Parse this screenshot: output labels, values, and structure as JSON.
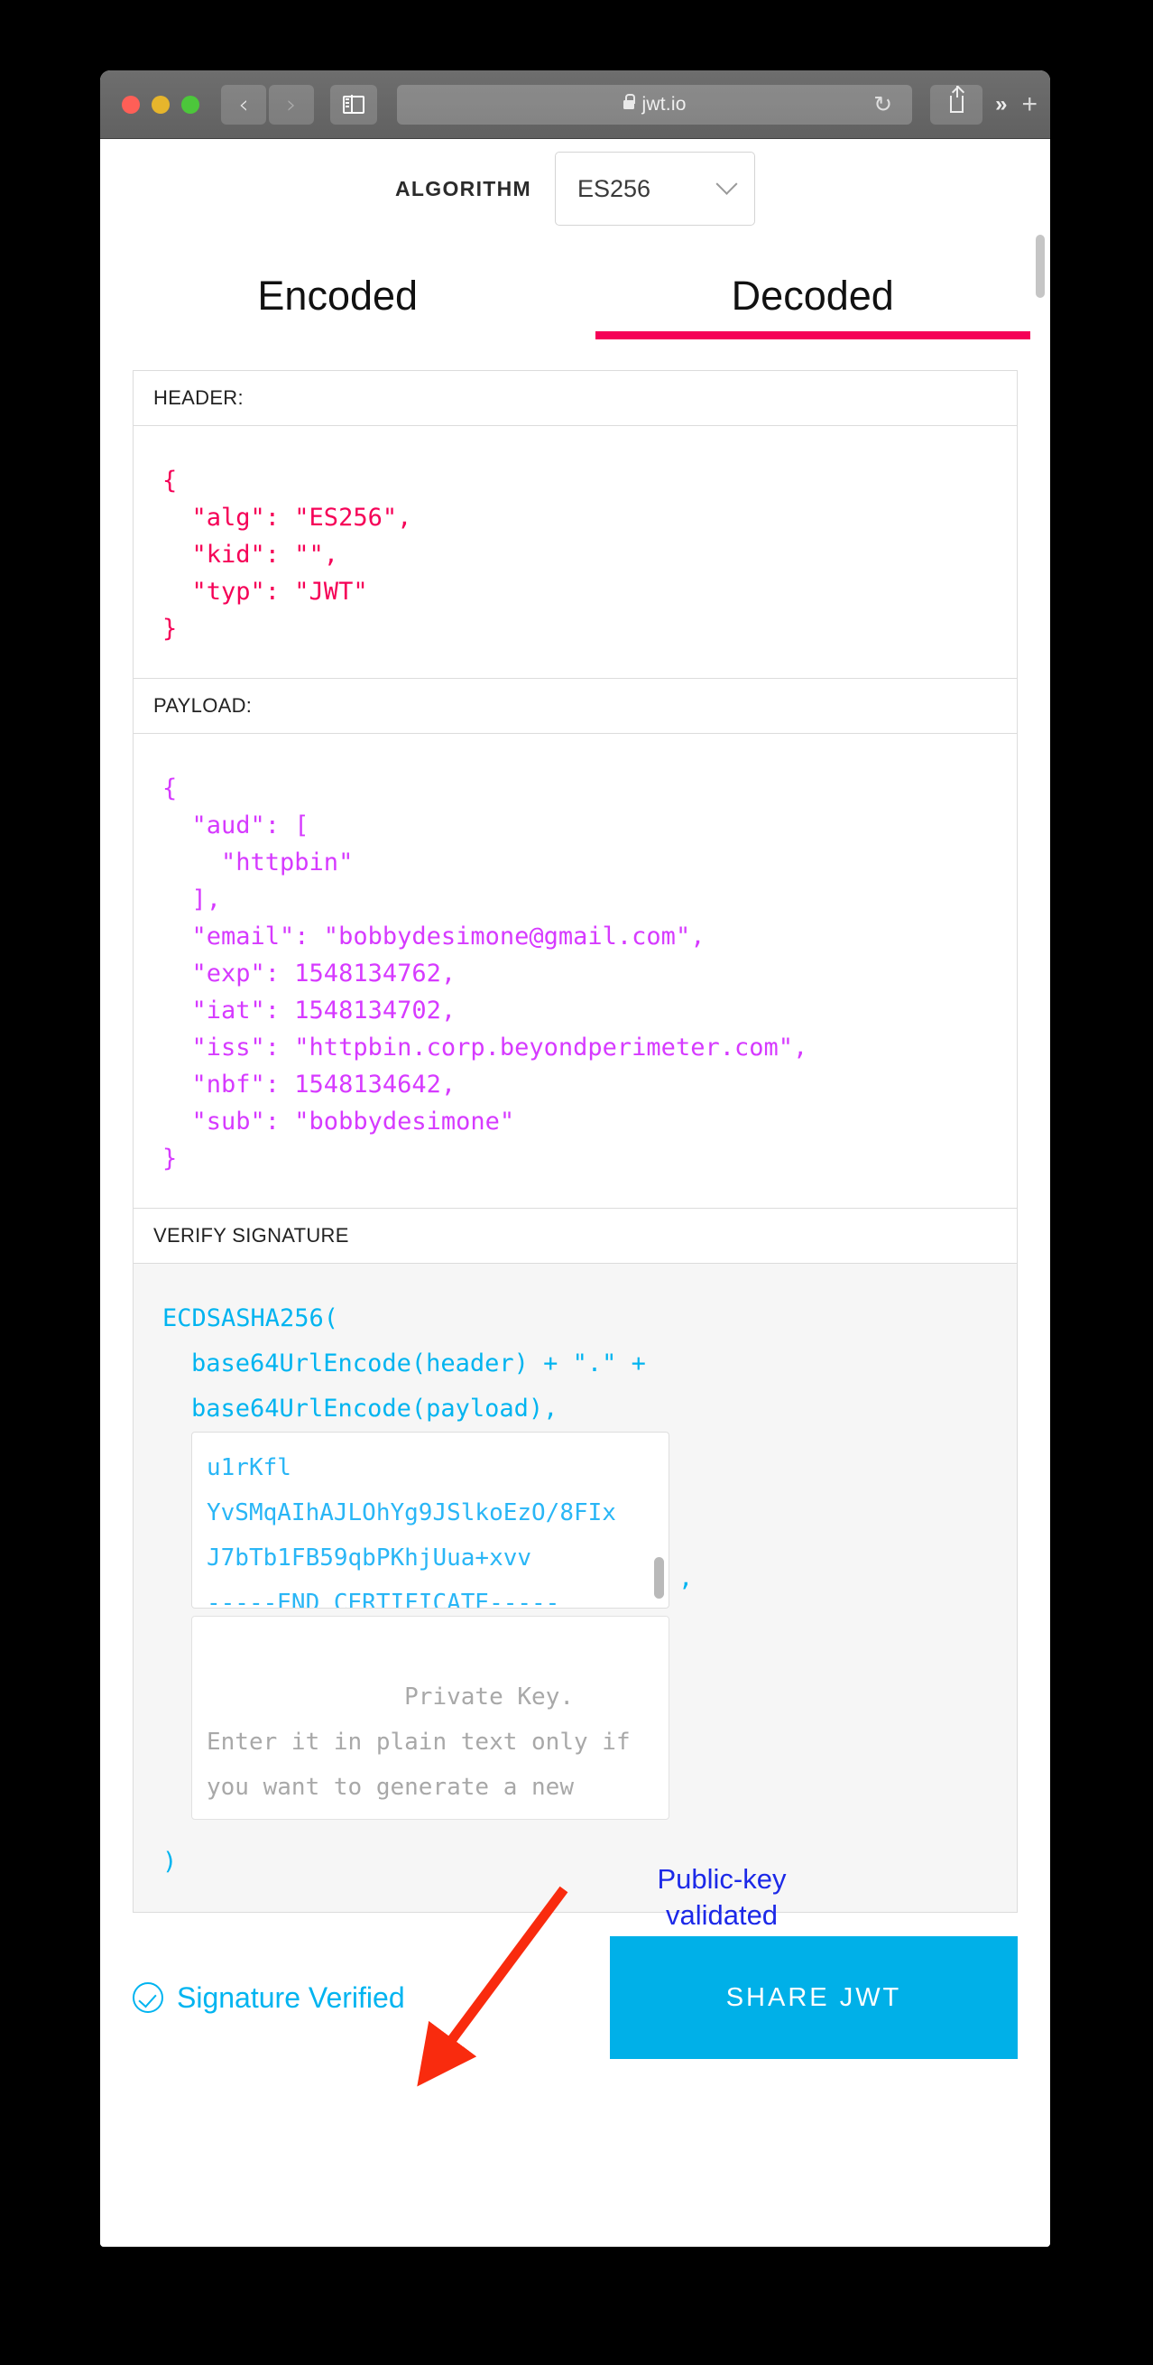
{
  "browser": {
    "url_text": "jwt.io",
    "lock_icon": "lock-icon",
    "reload_icon": "↻",
    "back_icon": "‹",
    "forward_icon": "›",
    "more_icon": "»",
    "newtab_icon": "+"
  },
  "page": {
    "algorithm": {
      "label": "ALGORITHM",
      "selected": "ES256"
    },
    "tabs": [
      {
        "label": "Encoded",
        "active": false
      },
      {
        "label": "Decoded",
        "active": true
      }
    ],
    "active_tab_color": "#f50057",
    "header_panel": {
      "title": "HEADER:",
      "color": "#f50057",
      "code": "{\n  \"alg\": \"ES256\",\n  \"kid\": \"\",\n  \"typ\": \"JWT\"\n}"
    },
    "payload_panel": {
      "title": "PAYLOAD:",
      "color": "#d63aff",
      "code": "{\n  \"aud\": [\n    \"httpbin\"\n  ],\n  \"email\": \"bobbydesimone@gmail.com\",\n  \"exp\": 1548134762,\n  \"iat\": 1548134702,\n  \"iss\": \"httpbin.corp.beyondperimeter.com\",\n  \"nbf\": 1548134642,\n  \"sub\": \"bobbydesimone\"\n}"
    },
    "signature_panel": {
      "title": "VERIFY SIGNATURE",
      "color": "#00b4f0",
      "line1": "ECDSASHA256(",
      "line2": "base64UrlEncode(header) + \".\" +",
      "line3": "base64UrlEncode(payload),",
      "public_key_value": "u1rKfl\nYvSMqAIhAJLOhYg9JSlkoEzO/8FIx\nJ7bTb1FB59qbPKhjUua+xvv\n-----END CERTIFICATE-----",
      "comma": ",",
      "private_key_placeholder": "Private Key. Enter it in plain text only if you want to generate a new token. The key never leaves your browser.",
      "close_paren": ")"
    },
    "footer": {
      "verified_label": "Signature Verified",
      "verified_color": "#00b4f0",
      "share_label": "SHARE JWT",
      "share_color": "#00b0e8"
    }
  },
  "annotations": {
    "public_key_note": "Public-key\nvalidated",
    "note_color": "#1c29e8",
    "arrow_color": "#f92b0e"
  }
}
